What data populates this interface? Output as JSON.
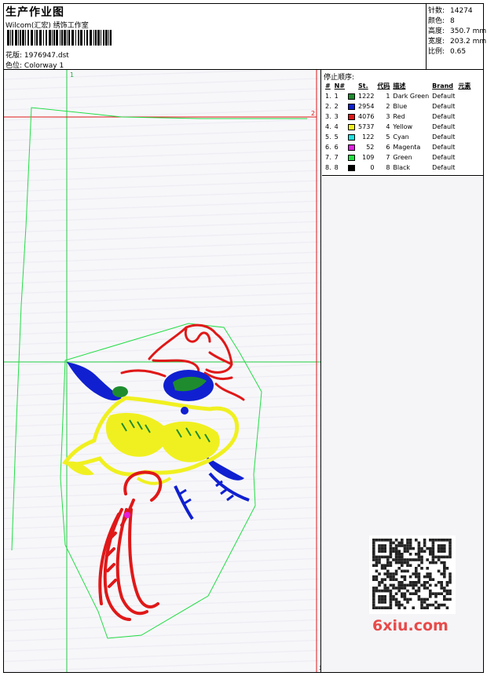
{
  "header": {
    "title": "生产作业图",
    "company": "Wilcom(汇宏) 绣饰工作室",
    "design_label": "花版:",
    "design_file": "1976947.dst",
    "colorway_label": "色位:",
    "colorway": "Colorway 1"
  },
  "stats": [
    {
      "label": "针数:",
      "value": "14274"
    },
    {
      "label": "颜色:",
      "value": "8"
    },
    {
      "label": "高度:",
      "value": "350.7 mm"
    },
    {
      "label": "宽度:",
      "value": "203.2 mm"
    },
    {
      "label": "比例:",
      "value": "0.65"
    }
  ],
  "sequence": {
    "title": "停止顺序:",
    "columns": [
      "#",
      "N#",
      "St.",
      "代码",
      "描述",
      "Brand",
      "元素"
    ],
    "rows": [
      {
        "idx": "1.",
        "n": "1",
        "color": "#1e8c2e",
        "st": "1222",
        "code": "1",
        "desc": "Dark Green",
        "brand": "Default"
      },
      {
        "idx": "2.",
        "n": "2",
        "color": "#1020d0",
        "st": "2954",
        "code": "2",
        "desc": "Blue",
        "brand": "Default"
      },
      {
        "idx": "3.",
        "n": "3",
        "color": "#e01818",
        "st": "4076",
        "code": "3",
        "desc": "Red",
        "brand": "Default"
      },
      {
        "idx": "4.",
        "n": "4",
        "color": "#f0f020",
        "st": "5737",
        "code": "4",
        "desc": "Yellow",
        "brand": "Default"
      },
      {
        "idx": "5.",
        "n": "5",
        "color": "#20e0e0",
        "st": "122",
        "code": "5",
        "desc": "Cyan",
        "brand": "Default"
      },
      {
        "idx": "6.",
        "n": "6",
        "color": "#e020e0",
        "st": "52",
        "code": "6",
        "desc": "Magenta",
        "brand": "Default"
      },
      {
        "idx": "7.",
        "n": "7",
        "color": "#20e040",
        "st": "109",
        "code": "7",
        "desc": "Green",
        "brand": "Default"
      },
      {
        "idx": "8.",
        "n": "8",
        "color": "#000000",
        "st": "0",
        "code": "8",
        "desc": "Black",
        "brand": "Default"
      }
    ]
  },
  "guides": {
    "v_label": "1",
    "h_label": "2",
    "b_label": "3"
  },
  "watermark": "6xiu.com"
}
